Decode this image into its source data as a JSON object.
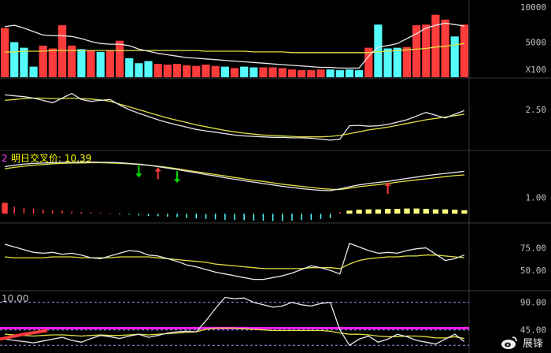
{
  "colors": {
    "up": "#ff3c3c",
    "down": "#54fcfc",
    "white": "#e8e8e8",
    "yellow": "#e0e040",
    "magenta": "#ff1cff",
    "grid": "#3a3a3a",
    "axis": "#c0c0c0",
    "caption": "#ffff00",
    "green": "#00e000"
  },
  "watermark": {
    "text": "展锋",
    "icon": "weibo-logo-icon"
  },
  "chart_data": [
    {
      "type": "bar",
      "panel": "volume",
      "y_ticks": [
        "10000",
        "5000",
        "X100"
      ],
      "ylim": [
        0,
        11000
      ],
      "values": [
        7000,
        5000,
        4200,
        1500,
        4500,
        4100,
        7400,
        4500,
        4000,
        3800,
        3600,
        3800,
        5200,
        2700,
        2000,
        2300,
        1900,
        1800,
        1900,
        1700,
        1600,
        1800,
        1600,
        1500,
        1300,
        1500,
        1400,
        1400,
        1400,
        1300,
        1100,
        1000,
        1000,
        1100,
        1100,
        1000,
        1100,
        1000,
        4200,
        7500,
        4100,
        4200,
        4300,
        7400,
        7500,
        8900,
        8200,
        5800,
        7500
      ],
      "up": [
        1,
        0,
        0,
        0,
        1,
        1,
        1,
        1,
        0,
        1,
        0,
        1,
        1,
        0,
        0,
        0,
        1,
        1,
        1,
        1,
        1,
        1,
        1,
        0,
        1,
        0,
        0,
        1,
        1,
        1,
        1,
        1,
        1,
        1,
        0,
        0,
        0,
        0,
        1,
        0,
        0,
        0,
        1,
        1,
        1,
        1,
        1,
        0,
        1
      ],
      "ma_white": [
        7200,
        7400,
        7000,
        6500,
        6000,
        5900,
        5900,
        5800,
        5500,
        5100,
        4800,
        4700,
        4700,
        4500,
        4000,
        3700,
        3400,
        3200,
        3000,
        2800,
        2700,
        2600,
        2500,
        2400,
        2300,
        2200,
        2100,
        2000,
        1900,
        1800,
        1700,
        1600,
        1500,
        1400,
        1400,
        1300,
        1300,
        1300,
        3000,
        4300,
        4500,
        4800,
        5500,
        6200,
        7000,
        7400,
        7700,
        7500,
        7300
      ],
      "ma_yellow": [
        3600,
        3600,
        3700,
        3700,
        3700,
        3800,
        3800,
        3800,
        3800,
        3800,
        3800,
        3800,
        3800,
        3800,
        3800,
        3800,
        3800,
        3800,
        3800,
        3800,
        3800,
        3700,
        3700,
        3700,
        3700,
        3700,
        3600,
        3600,
        3600,
        3600,
        3500,
        3500,
        3500,
        3500,
        3500,
        3500,
        3500,
        3500,
        3500,
        3600,
        3700,
        3800,
        3900,
        4000,
        4100,
        4300,
        4400,
        4600,
        4800
      ]
    },
    {
      "type": "line",
      "panel": "indicator-2",
      "y_ticks": [
        "2.50"
      ],
      "ylim": [
        1.7,
        3.1
      ],
      "series": [
        {
          "values": [
            2.82,
            2.8,
            2.78,
            2.75,
            2.7,
            2.65,
            2.75,
            2.85,
            2.72,
            2.68,
            2.7,
            2.72,
            2.6,
            2.5,
            2.42,
            2.35,
            2.28,
            2.22,
            2.17,
            2.12,
            2.07,
            2.04,
            2.01,
            1.98,
            1.95,
            1.93,
            1.92,
            1.91,
            1.9,
            1.9,
            1.89,
            1.89,
            1.88,
            1.86,
            1.84,
            1.86,
            2.15,
            2.16,
            2.14,
            2.15,
            2.18,
            2.23,
            2.28,
            2.36,
            2.44,
            2.38,
            2.32,
            2.4,
            2.48
          ]
        },
        {
          "values": [
            2.7,
            2.72,
            2.74,
            2.75,
            2.75,
            2.74,
            2.74,
            2.75,
            2.74,
            2.73,
            2.71,
            2.68,
            2.62,
            2.56,
            2.5,
            2.44,
            2.38,
            2.32,
            2.27,
            2.22,
            2.17,
            2.13,
            2.09,
            2.05,
            2.02,
            1.99,
            1.97,
            1.95,
            1.94,
            1.93,
            1.92,
            1.91,
            1.91,
            1.91,
            1.92,
            1.94,
            1.98,
            2.02,
            2.06,
            2.09,
            2.12,
            2.16,
            2.2,
            2.24,
            2.28,
            2.31,
            2.34,
            2.37,
            2.4
          ]
        }
      ]
    },
    {
      "type": "line",
      "panel": "indicator-3",
      "title": "明日交叉价: 10.39",
      "title_prefix": "2",
      "y_ticks": [
        "1.00"
      ],
      "ylim": [
        0.4,
        2.2
      ],
      "series": [
        {
          "values": [
            1.86,
            1.9,
            1.93,
            1.95,
            1.96,
            1.97,
            1.98,
            1.98,
            1.99,
            1.99,
            1.98,
            1.98,
            1.97,
            1.95,
            1.93,
            1.9,
            1.86,
            1.82,
            1.78,
            1.73,
            1.69,
            1.64,
            1.6,
            1.55,
            1.51,
            1.47,
            1.43,
            1.39,
            1.35,
            1.31,
            1.28,
            1.25,
            1.22,
            1.2,
            1.19,
            1.24,
            1.3,
            1.35,
            1.39,
            1.42,
            1.45,
            1.49,
            1.53,
            1.57,
            1.61,
            1.64,
            1.67,
            1.7,
            1.73
          ]
        },
        {
          "values": [
            1.8,
            1.84,
            1.87,
            1.9,
            1.92,
            1.94,
            1.95,
            1.96,
            1.96,
            1.97,
            1.97,
            1.96,
            1.95,
            1.94,
            1.92,
            1.9,
            1.87,
            1.84,
            1.8,
            1.76,
            1.72,
            1.68,
            1.64,
            1.6,
            1.56,
            1.52,
            1.48,
            1.45,
            1.41,
            1.37,
            1.34,
            1.31,
            1.28,
            1.25,
            1.23,
            1.22,
            1.26,
            1.3,
            1.33,
            1.36,
            1.39,
            1.43,
            1.46,
            1.49,
            1.52,
            1.55,
            1.58,
            1.61,
            1.63
          ]
        }
      ],
      "histogram": [
        0.25,
        0.16,
        0.14,
        0.12,
        0.1,
        0.08,
        0.07,
        0.05,
        0.04,
        0.03,
        0.02,
        0.01,
        -0.01,
        -0.02,
        -0.04,
        -0.05,
        -0.06,
        -0.07,
        -0.08,
        -0.1,
        -0.11,
        -0.12,
        -0.13,
        -0.14,
        -0.15,
        -0.15,
        -0.16,
        -0.16,
        -0.17,
        -0.17,
        -0.16,
        -0.15,
        -0.14,
        -0.12,
        -0.1,
        0.04,
        0.07,
        0.09,
        0.1,
        0.1,
        0.11,
        0.11,
        0.12,
        0.12,
        0.11,
        0.1,
        0.1,
        0.09,
        0.08
      ],
      "markers": [
        {
          "index": 14,
          "direction": "down",
          "color": "green"
        },
        {
          "index": 16,
          "direction": "up",
          "color": "red"
        },
        {
          "index": 18,
          "direction": "down",
          "color": "green"
        },
        {
          "index": 40,
          "direction": "up",
          "color": "red"
        }
      ]
    },
    {
      "type": "line",
      "panel": "indicator-4",
      "y_ticks": [
        "75.00",
        "50.00"
      ],
      "ylim": [
        30,
        100
      ],
      "series": [
        {
          "values": [
            79,
            76,
            73,
            70,
            69,
            70,
            68,
            69,
            67,
            64,
            63,
            66,
            69,
            72,
            71,
            67,
            66,
            63,
            60,
            56,
            54,
            51,
            48,
            46,
            44,
            42,
            40,
            40,
            42,
            44,
            47,
            51,
            55,
            53,
            50,
            46,
            80,
            76,
            72,
            69,
            70,
            69,
            72,
            74,
            75,
            68,
            61,
            63,
            67
          ]
        },
        {
          "values": [
            65,
            64,
            64,
            64,
            64,
            65,
            65,
            65,
            64,
            64,
            64,
            64,
            65,
            65,
            65,
            65,
            64,
            63,
            62,
            61,
            60,
            59,
            57,
            56,
            55,
            54,
            53,
            52,
            52,
            52,
            52,
            52,
            53,
            53,
            53,
            52,
            57,
            61,
            63,
            64,
            65,
            65,
            66,
            66,
            67,
            67,
            66,
            65,
            64
          ]
        }
      ]
    },
    {
      "type": "line",
      "panel": "indicator-5",
      "title": "10.00",
      "y_ticks": [
        "90.00",
        "45.00"
      ],
      "ylim": [
        10,
        105
      ],
      "reference_line": 48,
      "series": [
        {
          "values": [
            30,
            28,
            26,
            24,
            27,
            30,
            33,
            28,
            25,
            31,
            36,
            34,
            31,
            35,
            38,
            33,
            36,
            40,
            42,
            43,
            42,
            60,
            80,
            98,
            96,
            97,
            90,
            86,
            82,
            84,
            90,
            86,
            84,
            88,
            90,
            45,
            20,
            30,
            35,
            25,
            30,
            38,
            34,
            28,
            25,
            22,
            30,
            38,
            26
          ]
        },
        {
          "values": [
            38,
            37,
            36,
            35,
            36,
            37,
            37,
            36,
            35,
            36,
            37,
            36,
            36,
            37,
            38,
            37,
            38,
            39,
            40,
            41,
            42,
            46,
            48,
            48,
            48,
            47,
            46,
            45,
            44,
            44,
            44,
            44,
            44,
            44,
            43,
            40,
            38,
            38,
            37,
            35,
            34,
            34,
            35,
            35,
            34,
            32,
            32,
            34,
            31
          ]
        }
      ]
    }
  ]
}
